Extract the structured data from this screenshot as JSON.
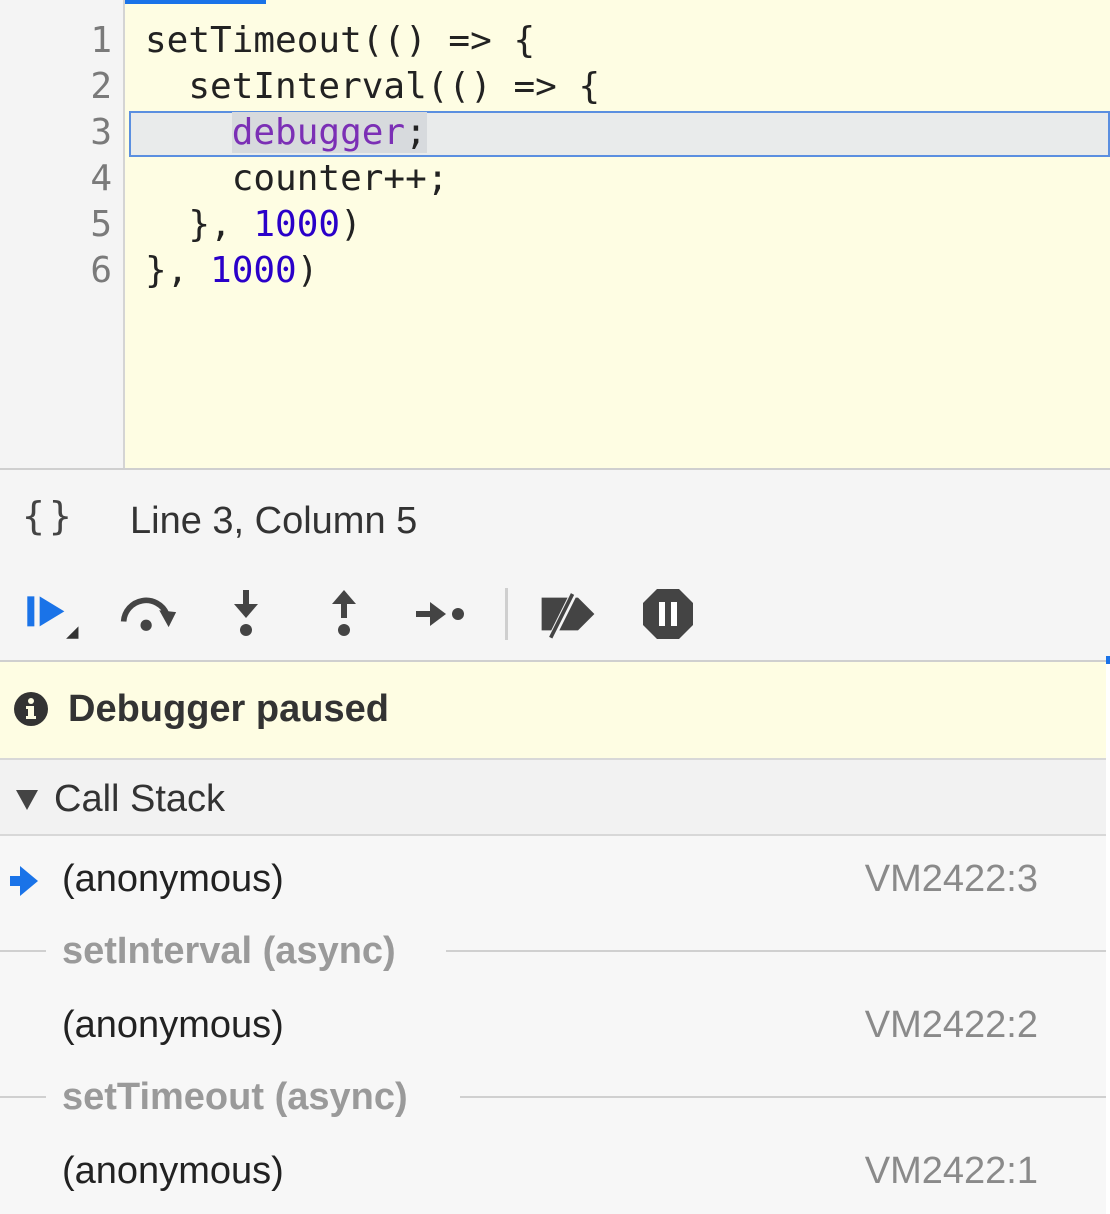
{
  "editor": {
    "line_numbers": [
      "1",
      "2",
      "3",
      "4",
      "5",
      "6"
    ],
    "lines": {
      "l1": "setTimeout(() => {",
      "l2": "  setInterval(() => {",
      "l3_indent": "    ",
      "l3_keyword": "debugger",
      "l3_semi": ";",
      "l4": "    counter++;",
      "l5_pre": "  }, ",
      "l5_num": "1000",
      "l5_post": ")",
      "l6_pre": "}, ",
      "l6_num": "1000",
      "l6_post": ")"
    },
    "current_line": 3
  },
  "statusbar": {
    "pretty_print_label": "{}",
    "cursor_position": "Line 3, Column 5"
  },
  "toolbar": {
    "buttons": [
      {
        "icon": "resume-icon"
      },
      {
        "icon": "step-over-icon"
      },
      {
        "icon": "step-into-icon"
      },
      {
        "icon": "step-out-icon"
      },
      {
        "icon": "step-icon"
      },
      {
        "icon": "deactivate-breakpoints-icon"
      },
      {
        "icon": "pause-on-exceptions-icon"
      }
    ]
  },
  "paused_banner": {
    "icon": "info-icon",
    "text": "Debugger paused"
  },
  "call_stack": {
    "title": "Call Stack",
    "frames": [
      {
        "name": "(anonymous)",
        "location": "VM2422:3",
        "current": true
      },
      {
        "async_label": "setInterval (async)"
      },
      {
        "name": "(anonymous)",
        "location": "VM2422:2"
      },
      {
        "async_label": "setTimeout (async)"
      },
      {
        "name": "(anonymous)",
        "location": "VM2422:1"
      }
    ]
  },
  "colors": {
    "accent": "#1a73e8",
    "editor_bg": "#fefde3",
    "keyword": "#7b2fb5",
    "number": "#2a00c9"
  }
}
